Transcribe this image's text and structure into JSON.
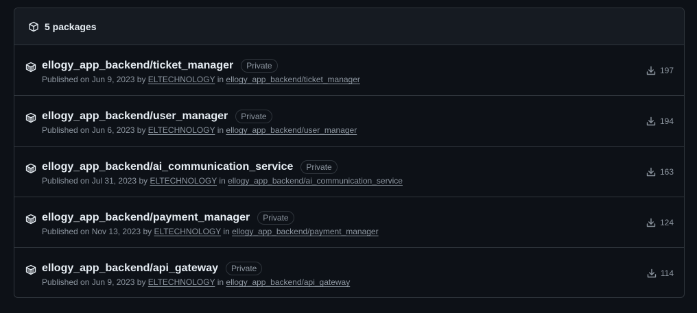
{
  "header": {
    "title": "5 packages",
    "icon": "package-icon"
  },
  "packages": [
    {
      "name": "ellogy_app_backend/ticket_manager",
      "badge": "Private",
      "published_prefix": "Published on Jun 9, 2023 by",
      "publisher": "ELTECHNOLOGY",
      "in_word": "in",
      "repo": "ellogy_app_backend/ticket_manager",
      "downloads": "197"
    },
    {
      "name": "ellogy_app_backend/user_manager",
      "badge": "Private",
      "published_prefix": "Published on Jun 6, 2023 by",
      "publisher": "ELTECHNOLOGY",
      "in_word": "in",
      "repo": "ellogy_app_backend/user_manager",
      "downloads": "194"
    },
    {
      "name": "ellogy_app_backend/ai_communication_service",
      "badge": "Private",
      "published_prefix": "Published on Jul 31, 2023 by",
      "publisher": "ELTECHNOLOGY",
      "in_word": "in",
      "repo": "ellogy_app_backend/ai_communication_service",
      "downloads": "163"
    },
    {
      "name": "ellogy_app_backend/payment_manager",
      "badge": "Private",
      "published_prefix": "Published on Nov 13, 2023 by",
      "publisher": "ELTECHNOLOGY",
      "in_word": "in",
      "repo": "ellogy_app_backend/payment_manager",
      "downloads": "124"
    },
    {
      "name": "ellogy_app_backend/api_gateway",
      "badge": "Private",
      "published_prefix": "Published on Jun 9, 2023 by",
      "publisher": "ELTECHNOLOGY",
      "in_word": "in",
      "repo": "ellogy_app_backend/api_gateway",
      "downloads": "114"
    }
  ],
  "colors": {
    "background": "#0d1117",
    "header_bg": "#161b22",
    "border": "#30363d",
    "text": "#e6edf3",
    "muted": "#8d96a0"
  }
}
